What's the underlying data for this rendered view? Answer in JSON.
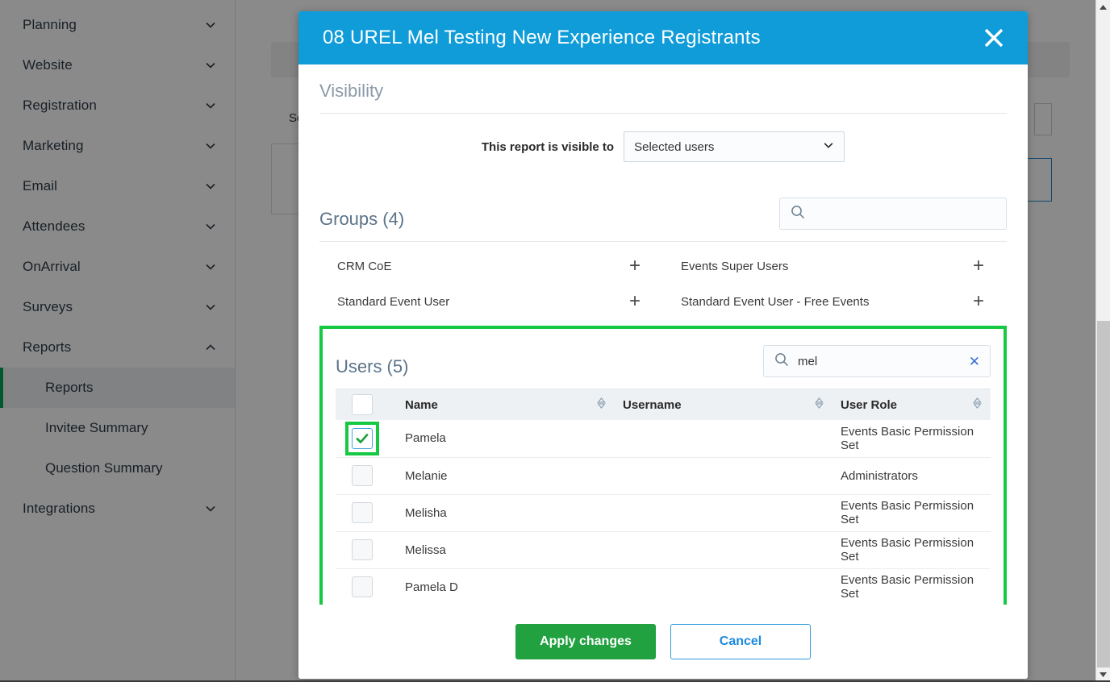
{
  "sidebar": {
    "items": [
      {
        "label": "Planning",
        "icon": "chevron-down-icon",
        "expanded": false
      },
      {
        "label": "Website",
        "icon": "chevron-down-icon",
        "expanded": false
      },
      {
        "label": "Registration",
        "icon": "chevron-down-icon",
        "expanded": false
      },
      {
        "label": "Marketing",
        "icon": "chevron-down-icon",
        "expanded": false
      },
      {
        "label": "Email",
        "icon": "chevron-down-icon",
        "expanded": false
      },
      {
        "label": "Attendees",
        "icon": "chevron-down-icon",
        "expanded": false
      },
      {
        "label": "OnArrival",
        "icon": "chevron-down-icon",
        "expanded": false
      },
      {
        "label": "Surveys",
        "icon": "chevron-down-icon",
        "expanded": false
      },
      {
        "label": "Reports",
        "icon": "chevron-up-icon",
        "expanded": true
      },
      {
        "label": "Integrations",
        "icon": "chevron-down-icon",
        "expanded": false
      }
    ],
    "reports_children": [
      {
        "label": "Reports",
        "active": true
      },
      {
        "label": "Invitee Summary",
        "active": false
      },
      {
        "label": "Question Summary",
        "active": false
      }
    ]
  },
  "background": {
    "partial_label": "Se"
  },
  "modal": {
    "title": "08 UREL Mel Testing New Experience Registrants",
    "close_icon": "close-icon",
    "header_color": "#0f9cd9",
    "visibility": {
      "section_title": "Visibility",
      "field_label": "This report is visible to",
      "select_value": "Selected users",
      "select_options": [
        "Selected users"
      ]
    },
    "groups": {
      "section_title": "Groups (4)",
      "count": 4,
      "search_value": "",
      "search_placeholder": "",
      "items": [
        {
          "name": "CRM CoE",
          "action": "+"
        },
        {
          "name": "Events Super Users",
          "action": "+"
        },
        {
          "name": "Standard Event User",
          "action": "+"
        },
        {
          "name": "Standard Event User - Free Events",
          "action": "+"
        }
      ]
    },
    "users": {
      "section_title": "Users (5)",
      "count": 5,
      "search_value": "mel",
      "search_placeholder": "",
      "clear_label": "✕",
      "highlight_color": "#16c943",
      "columns": [
        "Name",
        "Username",
        "User Role"
      ],
      "rows": [
        {
          "checked": true,
          "name": "Pamela",
          "username": "",
          "role": "Events Basic Permission Set"
        },
        {
          "checked": false,
          "name": "Melanie",
          "username": "",
          "role": "Administrators"
        },
        {
          "checked": false,
          "name": "Melisha",
          "username": "",
          "role": "Events Basic Permission Set"
        },
        {
          "checked": false,
          "name": "Melissa",
          "username": "",
          "role": "Events Basic Permission Set"
        },
        {
          "checked": false,
          "name": "Pamela D",
          "username": "",
          "role": "Events Basic Permission Set"
        }
      ]
    },
    "footer": {
      "apply_label": "Apply changes",
      "cancel_label": "Cancel",
      "apply_color": "#21a140",
      "cancel_color": "#1c8ade"
    }
  }
}
